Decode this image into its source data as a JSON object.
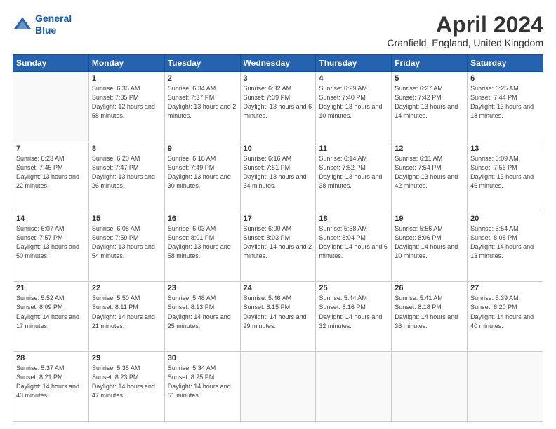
{
  "header": {
    "logo_line1": "General",
    "logo_line2": "Blue",
    "month_title": "April 2024",
    "location": "Cranfield, England, United Kingdom"
  },
  "days_of_week": [
    "Sunday",
    "Monday",
    "Tuesday",
    "Wednesday",
    "Thursday",
    "Friday",
    "Saturday"
  ],
  "weeks": [
    [
      {
        "day": "",
        "empty": true
      },
      {
        "day": "1",
        "sunrise": "Sunrise: 6:36 AM",
        "sunset": "Sunset: 7:35 PM",
        "daylight": "Daylight: 12 hours and 58 minutes."
      },
      {
        "day": "2",
        "sunrise": "Sunrise: 6:34 AM",
        "sunset": "Sunset: 7:37 PM",
        "daylight": "Daylight: 13 hours and 2 minutes."
      },
      {
        "day": "3",
        "sunrise": "Sunrise: 6:32 AM",
        "sunset": "Sunset: 7:39 PM",
        "daylight": "Daylight: 13 hours and 6 minutes."
      },
      {
        "day": "4",
        "sunrise": "Sunrise: 6:29 AM",
        "sunset": "Sunset: 7:40 PM",
        "daylight": "Daylight: 13 hours and 10 minutes."
      },
      {
        "day": "5",
        "sunrise": "Sunrise: 6:27 AM",
        "sunset": "Sunset: 7:42 PM",
        "daylight": "Daylight: 13 hours and 14 minutes."
      },
      {
        "day": "6",
        "sunrise": "Sunrise: 6:25 AM",
        "sunset": "Sunset: 7:44 PM",
        "daylight": "Daylight: 13 hours and 18 minutes."
      }
    ],
    [
      {
        "day": "7",
        "sunrise": "Sunrise: 6:23 AM",
        "sunset": "Sunset: 7:45 PM",
        "daylight": "Daylight: 13 hours and 22 minutes."
      },
      {
        "day": "8",
        "sunrise": "Sunrise: 6:20 AM",
        "sunset": "Sunset: 7:47 PM",
        "daylight": "Daylight: 13 hours and 26 minutes."
      },
      {
        "day": "9",
        "sunrise": "Sunrise: 6:18 AM",
        "sunset": "Sunset: 7:49 PM",
        "daylight": "Daylight: 13 hours and 30 minutes."
      },
      {
        "day": "10",
        "sunrise": "Sunrise: 6:16 AM",
        "sunset": "Sunset: 7:51 PM",
        "daylight": "Daylight: 13 hours and 34 minutes."
      },
      {
        "day": "11",
        "sunrise": "Sunrise: 6:14 AM",
        "sunset": "Sunset: 7:52 PM",
        "daylight": "Daylight: 13 hours and 38 minutes."
      },
      {
        "day": "12",
        "sunrise": "Sunrise: 6:11 AM",
        "sunset": "Sunset: 7:54 PM",
        "daylight": "Daylight: 13 hours and 42 minutes."
      },
      {
        "day": "13",
        "sunrise": "Sunrise: 6:09 AM",
        "sunset": "Sunset: 7:56 PM",
        "daylight": "Daylight: 13 hours and 46 minutes."
      }
    ],
    [
      {
        "day": "14",
        "sunrise": "Sunrise: 6:07 AM",
        "sunset": "Sunset: 7:57 PM",
        "daylight": "Daylight: 13 hours and 50 minutes."
      },
      {
        "day": "15",
        "sunrise": "Sunrise: 6:05 AM",
        "sunset": "Sunset: 7:59 PM",
        "daylight": "Daylight: 13 hours and 54 minutes."
      },
      {
        "day": "16",
        "sunrise": "Sunrise: 6:03 AM",
        "sunset": "Sunset: 8:01 PM",
        "daylight": "Daylight: 13 hours and 58 minutes."
      },
      {
        "day": "17",
        "sunrise": "Sunrise: 6:00 AM",
        "sunset": "Sunset: 8:03 PM",
        "daylight": "Daylight: 14 hours and 2 minutes."
      },
      {
        "day": "18",
        "sunrise": "Sunrise: 5:58 AM",
        "sunset": "Sunset: 8:04 PM",
        "daylight": "Daylight: 14 hours and 6 minutes."
      },
      {
        "day": "19",
        "sunrise": "Sunrise: 5:56 AM",
        "sunset": "Sunset: 8:06 PM",
        "daylight": "Daylight: 14 hours and 10 minutes."
      },
      {
        "day": "20",
        "sunrise": "Sunrise: 5:54 AM",
        "sunset": "Sunset: 8:08 PM",
        "daylight": "Daylight: 14 hours and 13 minutes."
      }
    ],
    [
      {
        "day": "21",
        "sunrise": "Sunrise: 5:52 AM",
        "sunset": "Sunset: 8:09 PM",
        "daylight": "Daylight: 14 hours and 17 minutes."
      },
      {
        "day": "22",
        "sunrise": "Sunrise: 5:50 AM",
        "sunset": "Sunset: 8:11 PM",
        "daylight": "Daylight: 14 hours and 21 minutes."
      },
      {
        "day": "23",
        "sunrise": "Sunrise: 5:48 AM",
        "sunset": "Sunset: 8:13 PM",
        "daylight": "Daylight: 14 hours and 25 minutes."
      },
      {
        "day": "24",
        "sunrise": "Sunrise: 5:46 AM",
        "sunset": "Sunset: 8:15 PM",
        "daylight": "Daylight: 14 hours and 29 minutes."
      },
      {
        "day": "25",
        "sunrise": "Sunrise: 5:44 AM",
        "sunset": "Sunset: 8:16 PM",
        "daylight": "Daylight: 14 hours and 32 minutes."
      },
      {
        "day": "26",
        "sunrise": "Sunrise: 5:41 AM",
        "sunset": "Sunset: 8:18 PM",
        "daylight": "Daylight: 14 hours and 36 minutes."
      },
      {
        "day": "27",
        "sunrise": "Sunrise: 5:39 AM",
        "sunset": "Sunset: 8:20 PM",
        "daylight": "Daylight: 14 hours and 40 minutes."
      }
    ],
    [
      {
        "day": "28",
        "sunrise": "Sunrise: 5:37 AM",
        "sunset": "Sunset: 8:21 PM",
        "daylight": "Daylight: 14 hours and 43 minutes."
      },
      {
        "day": "29",
        "sunrise": "Sunrise: 5:35 AM",
        "sunset": "Sunset: 8:23 PM",
        "daylight": "Daylight: 14 hours and 47 minutes."
      },
      {
        "day": "30",
        "sunrise": "Sunrise: 5:34 AM",
        "sunset": "Sunset: 8:25 PM",
        "daylight": "Daylight: 14 hours and 51 minutes."
      },
      {
        "day": "",
        "empty": true
      },
      {
        "day": "",
        "empty": true
      },
      {
        "day": "",
        "empty": true
      },
      {
        "day": "",
        "empty": true
      }
    ]
  ]
}
